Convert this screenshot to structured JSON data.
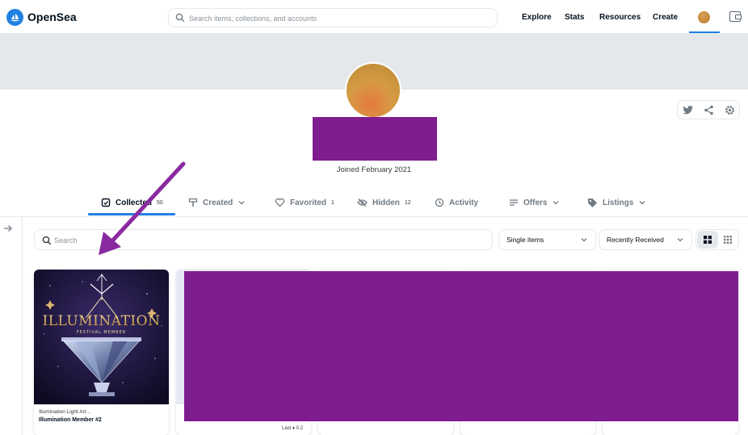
{
  "header": {
    "brand": "OpenSea",
    "search_placeholder": "Search items, collections, and accounts",
    "nav": [
      "Explore",
      "Stats",
      "Resources",
      "Create"
    ]
  },
  "profile": {
    "joined": "Joined February 2021"
  },
  "tabs": [
    {
      "label": "Collected",
      "count": "50",
      "icon": "collected-icon"
    },
    {
      "label": "Created",
      "count": "",
      "icon": "created-icon"
    },
    {
      "label": "Favorited",
      "count": "1",
      "icon": "heart-icon"
    },
    {
      "label": "Hidden",
      "count": "12",
      "icon": "eye-off-icon"
    },
    {
      "label": "Activity",
      "count": "",
      "icon": "history-icon"
    },
    {
      "label": "Offers",
      "count": "",
      "icon": "list-icon"
    },
    {
      "label": "Listings",
      "count": "",
      "icon": "tag-icon"
    }
  ],
  "filters": {
    "search_placeholder": "Search",
    "items_select": "Single items",
    "sort_select": "Recently Received"
  },
  "cards": [
    {
      "collection": "Illumination Light Art...",
      "name": "Illumination Member #2",
      "image_text": "ILLUMINATION",
      "image_subtext": "FESTIVAL MEMBER"
    }
  ],
  "prices": {
    "price": "0.2",
    "last_label": "Last",
    "last_value": "0.2"
  },
  "colors": {
    "accent": "#2081e2",
    "redaction": "#7f1d8f",
    "annotation_arrow": "#8a2aa0"
  }
}
